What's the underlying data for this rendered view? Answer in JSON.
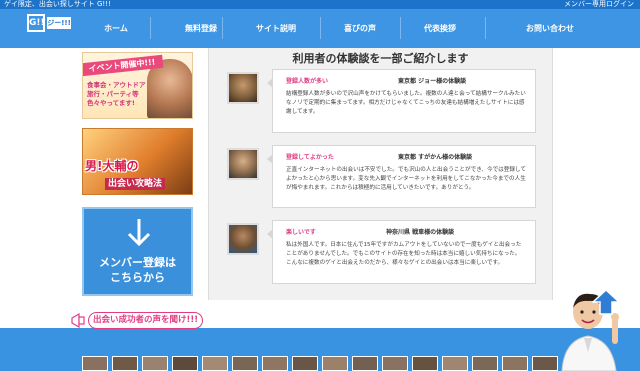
{
  "topbar": {
    "left_text": "ゲイ限定、出会い探しサイト G!!!",
    "right_text": "メンバー専用ログイン"
  },
  "logo": {
    "mark": "G!!",
    "name": "ジー!!!"
  },
  "nav": {
    "items": [
      {
        "label": "ホーム"
      },
      {
        "label": "無料登録"
      },
      {
        "label": "サイト説明"
      },
      {
        "label": "喜びの声"
      },
      {
        "label": "代表挨拶"
      },
      {
        "label": "お問い合わせ"
      }
    ]
  },
  "sidebar": {
    "banner1": {
      "ribbon": "イベント開催中!!!",
      "lines": [
        "食事会・アウトドア",
        "旅行・パーティ等",
        "色々やってます!"
      ]
    },
    "banner2": {
      "big": "男!大輔の",
      "small": "出会い攻略法"
    },
    "register": {
      "line1": "メンバー登録は",
      "line2": "こちらから"
    }
  },
  "main": {
    "heading": "利用者の体験談を一部ご紹介します",
    "testimonials": [
      {
        "tag": "登録人数が多い",
        "author": "東京都 ジョー様の体験談",
        "body": "結構登録人数が多いので沢山声をかけてもらいました。複数の人達と会って結構サークルみたいなノリで定期的に集まってます。相方だけじゃなくてこっちの友達も結構増えたしサイトには感謝してます。"
      },
      {
        "tag": "登録してよかった",
        "author": "東京都 すがかん様の体験談",
        "body": "正直インターネットの出会いは不安でした。でも沢山の人と出会うことができ、今では登録してよかったと心から思います。変な先入観でインターネットを利用をしてこなかった今までの人生が悔やまれます。これからは積極的に活用していきたいです。ありがとう。"
      },
      {
        "tag": "楽しいです",
        "author": "神奈川県 戦車様の体験談",
        "body": "私は外国人です。日本に住んで15年ですがカムアウトをしていないので一度もゲイと出会ったことがありませんでした。でもこのサイトの存在を知った時は本当に嬉しい気持ちになった。こんなに複数のゲイと出会えたのだから、様々なゲイとの出会いは本当に楽しいです。"
      }
    ]
  },
  "footer": {
    "callout": "出会い成功者の声を聞け!!!"
  },
  "colors": {
    "primary": "#3d95e3",
    "dark": "#1c73c9",
    "accent": "#e23c83"
  }
}
